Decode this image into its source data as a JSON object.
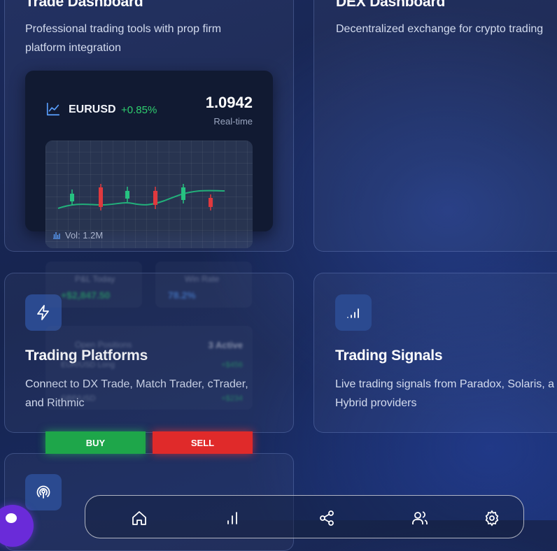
{
  "cards": {
    "trade": {
      "title": "Trade Dashboard",
      "desc_line1": "Professional trading tools with prop firm",
      "desc_line2": "platform integration"
    },
    "dex": {
      "title": "DEX Dashboard",
      "desc": "Decentralized exchange for crypto trading"
    },
    "platforms": {
      "title": "Trading Platforms",
      "desc_line1": "Connect to DX Trade, Match Trader, cTrader,",
      "desc_line2": "and Rithmic"
    },
    "signals": {
      "title": "Trading Signals",
      "desc_line1": "Live trading signals from Paradox, Solaris, a",
      "desc_line2": "Hybrid providers"
    }
  },
  "chart_widget": {
    "symbol": "EURUSD",
    "change": "+0.85%",
    "price": "1.0942",
    "price_label": "Real-time",
    "volume": "Vol: 1.2M"
  },
  "ghost_stats": {
    "pnl_label": "P&L Today",
    "pnl_value": "+$2,847.50",
    "winrate_label": "Win Rate",
    "winrate_value": "78.2%",
    "sessions_label": "Open Positions",
    "sessions_value": "3 Active",
    "row1_label": "EUR/USD Long",
    "row1_value": "+$456",
    "row2_label": "GBP/USD",
    "row2_value": "+$234"
  },
  "buttons": {
    "buy": "BUY",
    "sell": "SELL"
  },
  "colors": {
    "buy": "#1ea64a",
    "sell": "#e02a2a",
    "accent_green": "#2fcf6f",
    "icon_blue": "#2b4a90"
  },
  "nav": {
    "items": [
      "home-icon",
      "bar-chart-icon",
      "share-icon",
      "users-icon",
      "settings-icon"
    ]
  }
}
